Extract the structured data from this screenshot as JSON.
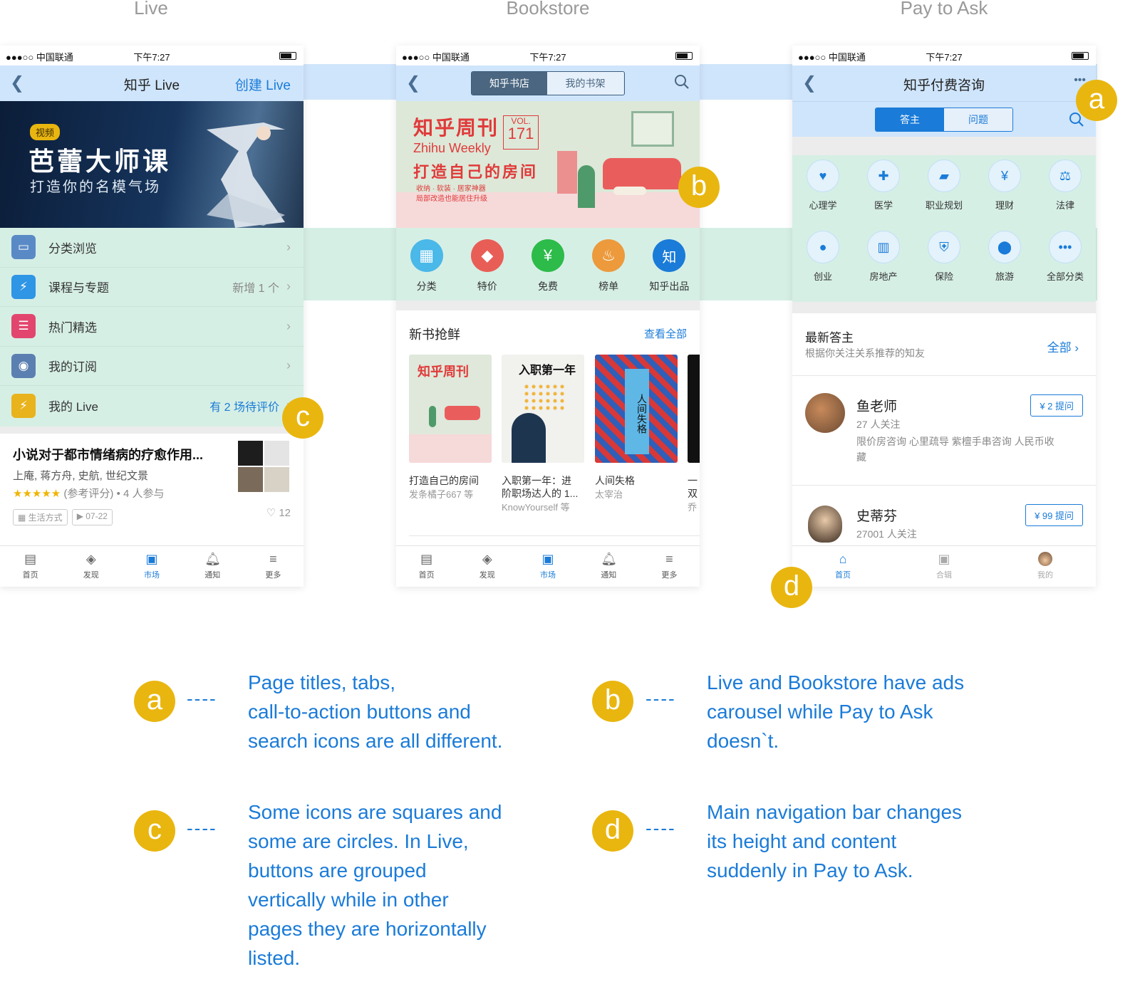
{
  "columns": {
    "live": "Live",
    "bookstore": "Bookstore",
    "pay": "Pay to Ask"
  },
  "status": {
    "carrier": "●●●○○ 中国联通 ",
    "time": "下午7:27"
  },
  "live": {
    "nav_title": "知乎 Live",
    "nav_cta": "创建 Live",
    "banner": {
      "tag": "视频",
      "title": "芭蕾大师课",
      "subtitle": "打造你的名模气场"
    },
    "menu": [
      {
        "label": "分类浏览",
        "right": ""
      },
      {
        "label": "课程与专题",
        "right": "新增 1 个"
      },
      {
        "label": "热门精选",
        "right": ""
      },
      {
        "label": "我的订阅",
        "right": ""
      },
      {
        "label": "我的 Live",
        "right": "有 2 场待评价"
      }
    ],
    "card": {
      "title": "小说对于都市情绪病的疗愈作用...",
      "authors": "上庵, 蒋方舟, 史航, 世纪文景",
      "stars": "★★★★★",
      "meta": "(参考评分) • 4 人参与",
      "tag1": "生活方式",
      "tag2": "07-22",
      "likes": "12"
    },
    "tabs": [
      "首页",
      "发现",
      "市场",
      "通知",
      "更多"
    ]
  },
  "bookstore": {
    "seg_on": "知乎书店",
    "seg_off": "我的书架",
    "banner": {
      "title": "知乎周刊",
      "en": "Zhihu Weekly",
      "vol": "VOL.",
      "num": "171",
      "headline": "打造自己的房间",
      "line1": "收纳 · 软装 · 居家神器",
      "line2": "局部改造也能居住升级"
    },
    "cats": [
      "分类",
      "特价",
      "免费",
      "榜单",
      "知乎出品"
    ],
    "section_title": "新书抢鲜",
    "see_all": "查看全部",
    "books": [
      {
        "cover": "知乎周刊",
        "t1": "打造自己的房间",
        "t2": "",
        "sub": "发条橘子667 等"
      },
      {
        "cover": "入职第一年",
        "t1": "入职第一年：进",
        "t2": "阶职场达人的 1...",
        "sub": "KnowYourself 等"
      },
      {
        "cover": "人间失格",
        "t1": "人间失格",
        "t2": "",
        "sub": "太宰治"
      },
      {
        "cover": "",
        "t1": "一",
        "t2": "双",
        "sub": "乔"
      }
    ],
    "tabs": [
      "首页",
      "发现",
      "市场",
      "通知",
      "更多"
    ]
  },
  "pay": {
    "nav_title": "知乎付费咨询",
    "more": "•••",
    "seg_on": "答主",
    "seg_off": "问题",
    "cats": [
      "心理学",
      "医学",
      "职业规划",
      "理财",
      "法律",
      "创业",
      "房地产",
      "保险",
      "旅游",
      "全部分类"
    ],
    "section_title": "最新答主",
    "section_sub": "根据你关注关系推荐的知友",
    "section_all": "全部 ›",
    "people": [
      {
        "name": "鱼老师",
        "follow": "27 人关注",
        "desc1": "限价房咨询 心里疏导 紫檀手串咨询 人民币收",
        "desc2": "藏",
        "btn": "¥ 2 提问"
      },
      {
        "name": "史蒂芬",
        "follow": "27001 人关注",
        "desc1": "",
        "desc2": "",
        "btn": "¥ 99 提问"
      }
    ],
    "tabs": [
      "首页",
      "合辑",
      "我的"
    ]
  },
  "badges": {
    "a": "a",
    "b": "b",
    "c": "c",
    "d": "d"
  },
  "notes": {
    "dash": "----",
    "a": [
      "Page titles, tabs,",
      "call-to-action buttons and",
      "search icons are all different."
    ],
    "b": [
      "Live and Bookstore have ads",
      "carousel while Pay to Ask",
      "doesn`t."
    ],
    "c": [
      "Some icons are squares and",
      "some are circles. In Live,",
      "buttons are grouped",
      "vertically while in other",
      "pages they are horizontally",
      "listed."
    ],
    "d": [
      "Main navigation bar changes",
      "its height and content",
      "suddenly in Pay to Ask."
    ]
  },
  "colors": {
    "accent": "#1a7bd8",
    "badge": "#e9b60f",
    "nav": "#cfe5fb",
    "green": "#d6efe5"
  }
}
